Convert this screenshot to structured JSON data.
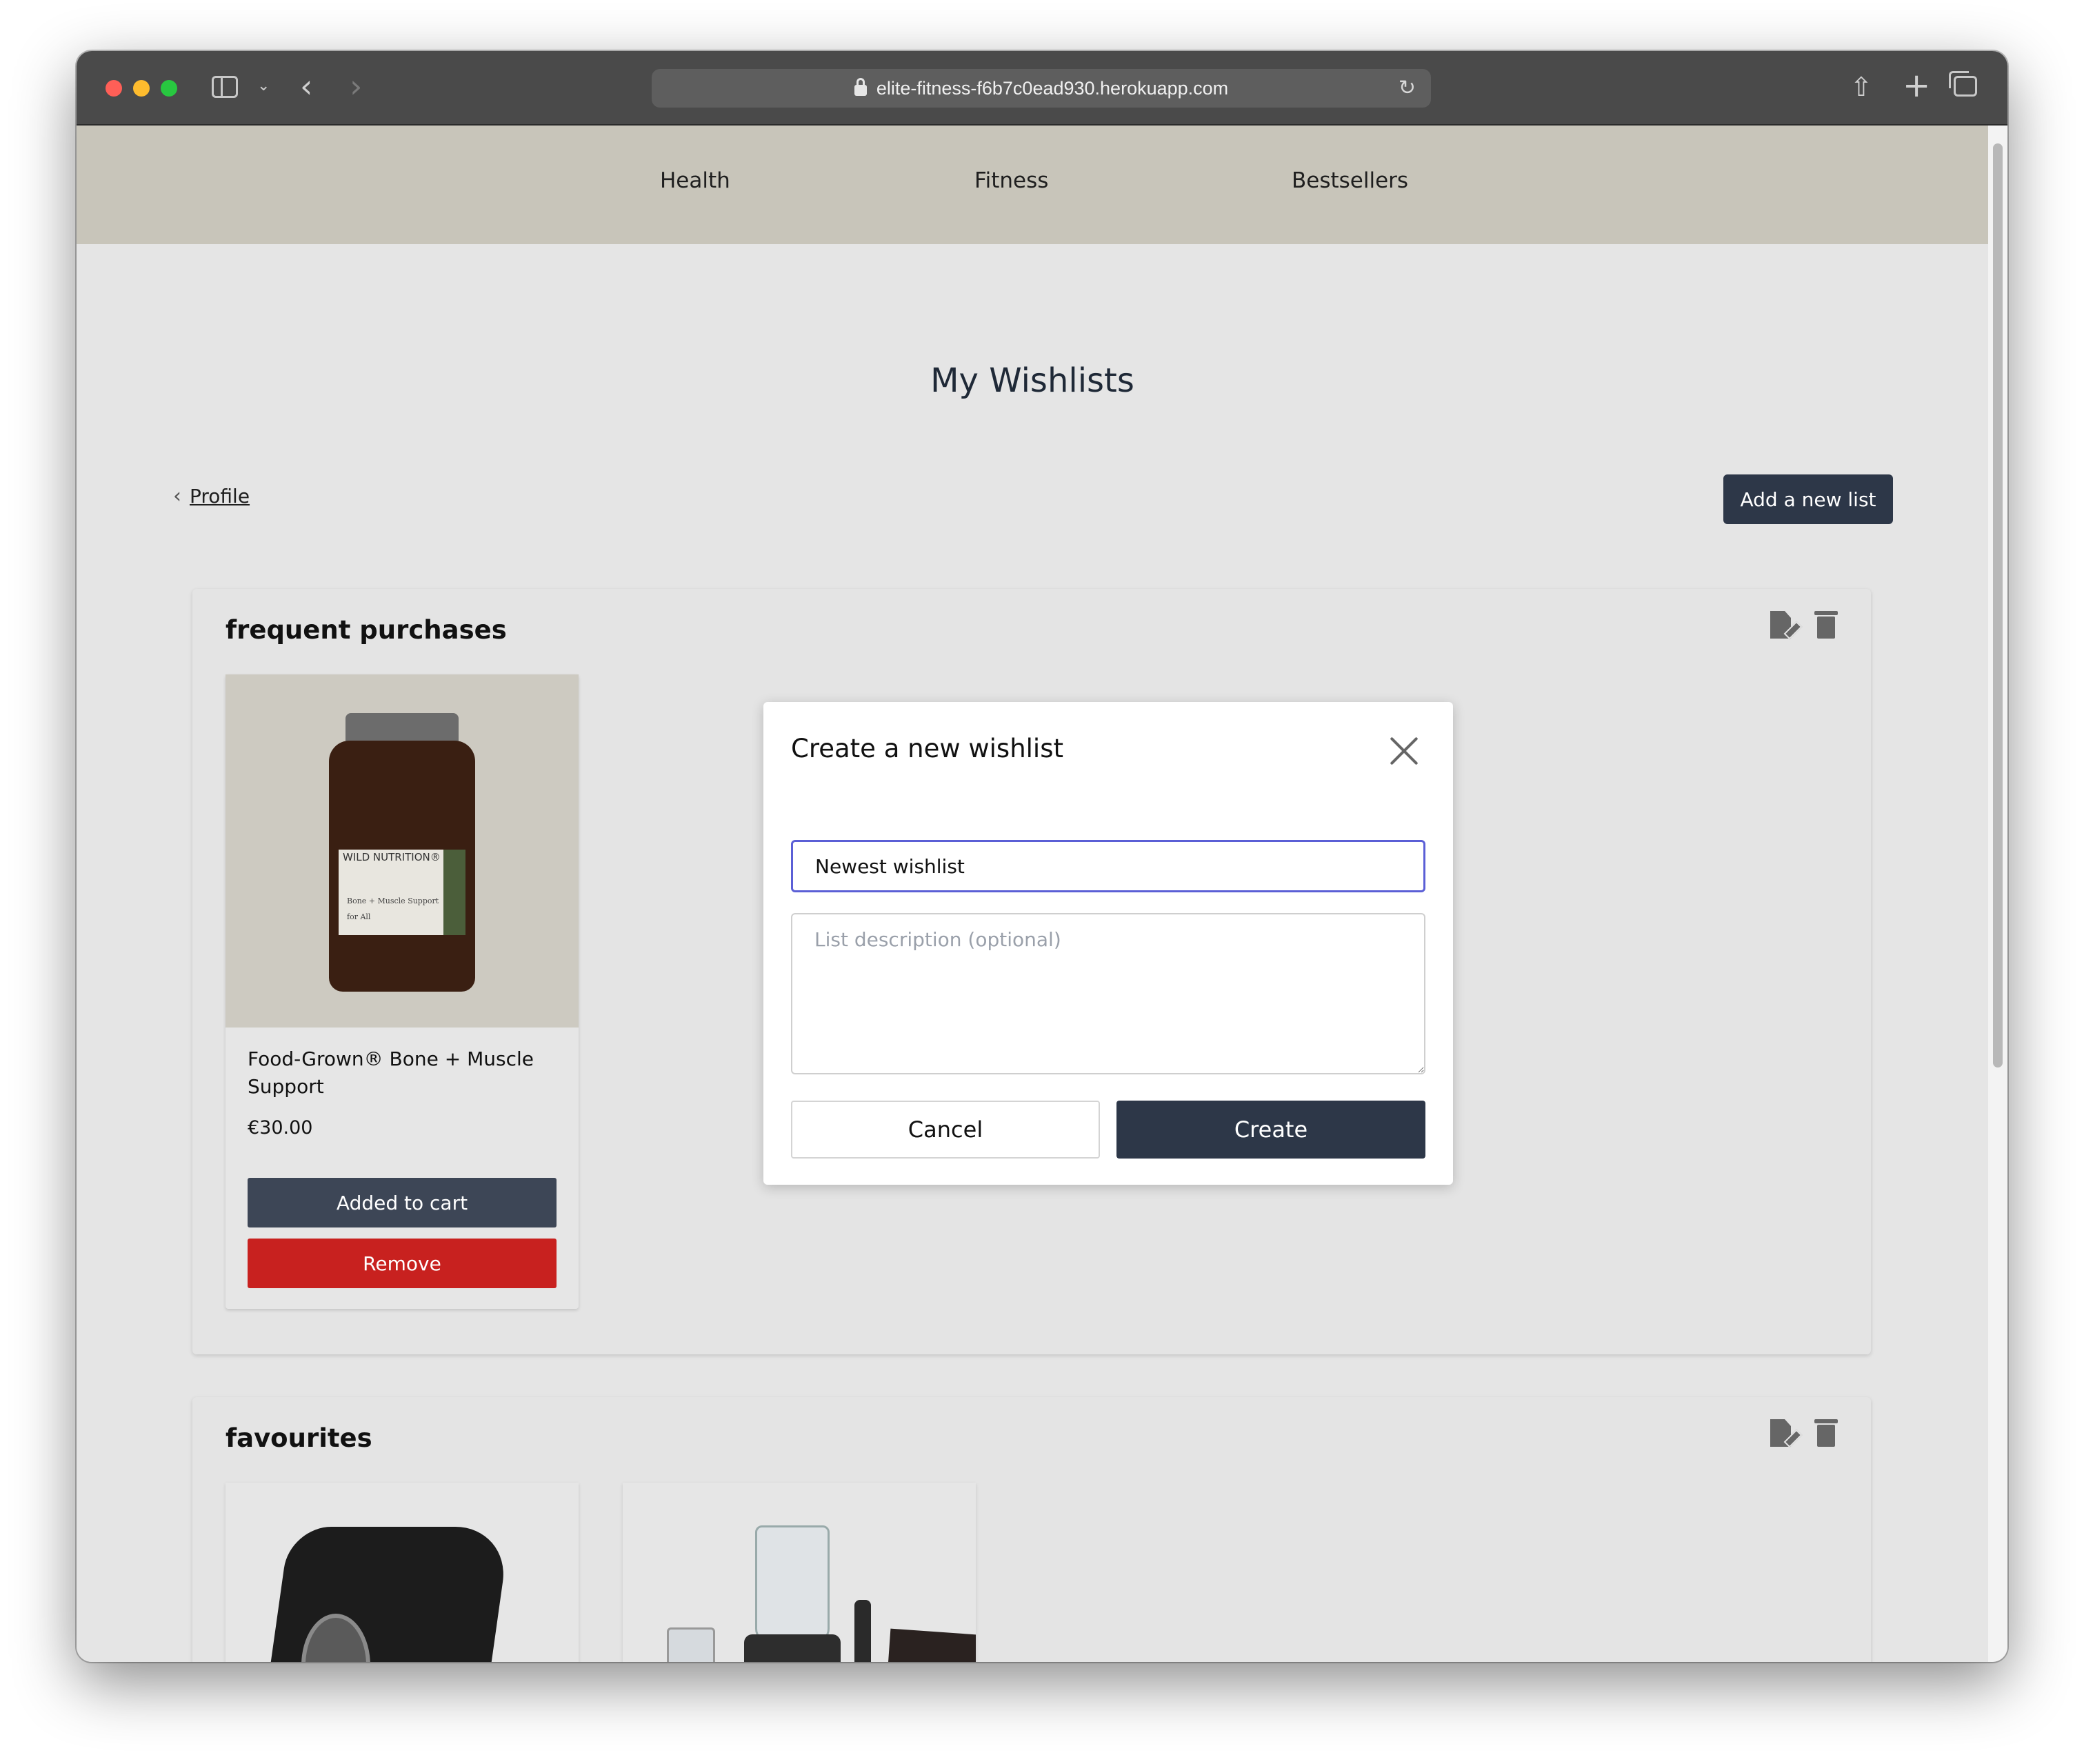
{
  "browser": {
    "url": "elite-fitness-f6b7c0ead930.herokuapp.com"
  },
  "nav": {
    "items": [
      "Health",
      "Fitness",
      "Bestsellers"
    ]
  },
  "page": {
    "title": "My Wishlists",
    "back_label": "Profile",
    "add_list_label": "Add a new list"
  },
  "wishlists": [
    {
      "title": "frequent purchases",
      "products": [
        {
          "name": "Food-Grown® Bone + Muscle Support",
          "price": "€30.00",
          "added_label": "Added to cart",
          "remove_label": "Remove",
          "image": {
            "brand": "WILD NUTRITION®",
            "line1": "Bone + Muscle Support",
            "line2": "for All"
          }
        }
      ]
    },
    {
      "title": "favourites"
    }
  ],
  "modal": {
    "title": "Create a new wishlist",
    "name_value": "Newest wishlist",
    "description_placeholder": "List description (optional)",
    "cancel_label": "Cancel",
    "create_label": "Create"
  },
  "colors": {
    "nav_bg": "#c8c5ba",
    "primary": "#2d3748",
    "danger": "#c8211f",
    "focus": "#5b5fd6"
  }
}
